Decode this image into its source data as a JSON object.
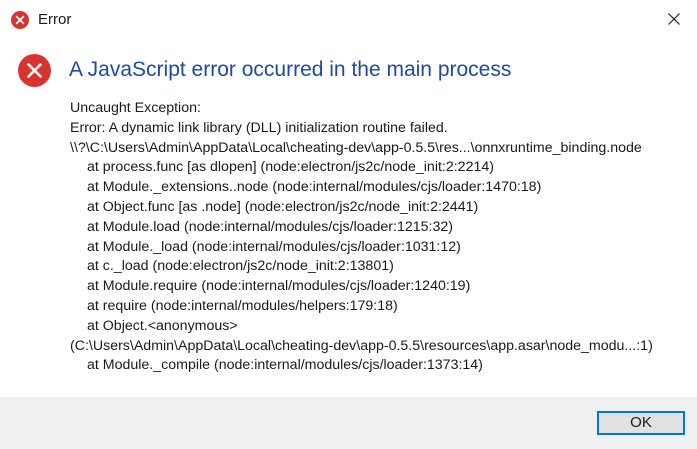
{
  "window": {
    "title": "Error",
    "close_icon": "close-icon",
    "title_icon": "error-icon"
  },
  "dialog": {
    "icon": "error-icon",
    "heading": "A JavaScript error occurred in the main process",
    "message_lines": [
      "Uncaught Exception:",
      "Error: A dynamic link library (DLL) initialization routine failed.",
      "\\\\?\\C:\\Users\\Admin\\AppData\\Local\\cheating-dev\\app-0.5.5\\res...\\onnxruntime_binding.node",
      "at process.func [as dlopen] (node:electron/js2c/node_init:2:2214)",
      "at Module._extensions..node (node:internal/modules/cjs/loader:1470:18)",
      "at Object.func [as .node] (node:electron/js2c/node_init:2:2441)",
      "at Module.load (node:internal/modules/cjs/loader:1215:32)",
      "at Module._load (node:internal/modules/cjs/loader:1031:12)",
      "at c._load (node:electron/js2c/node_init:2:13801)",
      "at Module.require (node:internal/modules/cjs/loader:1240:19)",
      "at require (node:internal/modules/helpers:179:18)",
      "at Object.<anonymous>",
      "(C:\\Users\\Admin\\AppData\\Local\\cheating-dev\\app-0.5.5\\resources\\app.asar\\node_modu...:1)",
      "at Module._compile (node:internal/modules/cjs/loader:1373:14)"
    ],
    "ok_label": "OK"
  },
  "colors": {
    "heading": "#1c4aa6",
    "error_red": "#d8332f",
    "footer_bg": "#f0f0f0",
    "button_border": "#0078d7",
    "button_bg": "#e1e1e1"
  }
}
